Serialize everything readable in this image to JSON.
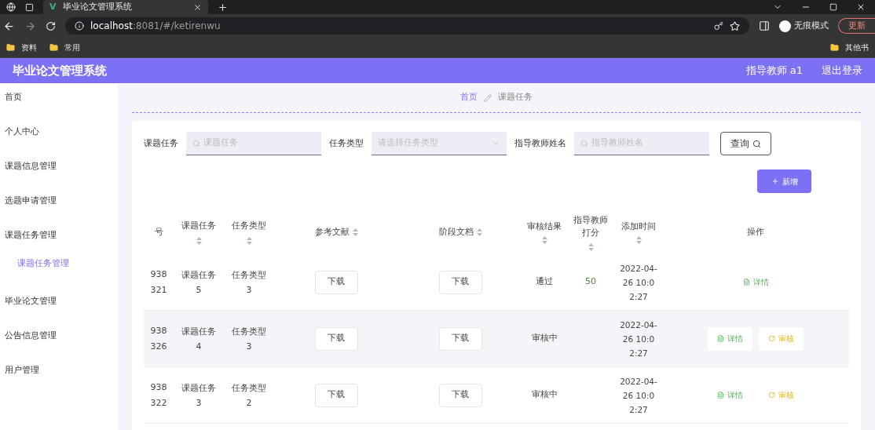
{
  "browser": {
    "tab_logo": "V",
    "tab_title": "毕业论文管理系统",
    "url_host": "localhost",
    "url_rest": ":8081/#/ketirenwu",
    "profile": "无痕模式",
    "update_button": "更新",
    "bookmarks": [
      "资料",
      "常用"
    ],
    "other_bookmarks": "其他书"
  },
  "header": {
    "title": "毕业论文管理系统",
    "user": "指导教师 a1",
    "logout": "退出登录"
  },
  "sidebar": {
    "items": [
      {
        "label": "首页",
        "selected": false
      },
      {
        "label": "个人中心",
        "selected": false
      },
      {
        "label": "课题信息管理",
        "selected": false
      },
      {
        "label": "选题申请管理",
        "selected": false
      },
      {
        "label": "课题任务管理",
        "selected": false,
        "children": [
          {
            "label": "课题任务管理",
            "selected": true
          }
        ]
      },
      {
        "label": "毕业论文管理",
        "selected": false
      },
      {
        "label": "公告信息管理",
        "selected": false
      },
      {
        "label": "用户管理",
        "selected": false
      }
    ]
  },
  "breadcrumb": [
    "首页",
    "课题任务"
  ],
  "search": {
    "fields": [
      {
        "label": "课题任务",
        "placeholder": "课题任务",
        "kind": "input"
      },
      {
        "label": "任务类型",
        "placeholder": "请选择任务类型",
        "kind": "select"
      },
      {
        "label": "指导教师姓名",
        "placeholder": "指导教师姓名",
        "kind": "input"
      }
    ],
    "query_button": "查询",
    "add_button": "新增"
  },
  "table": {
    "columns": [
      {
        "label": "号",
        "sortable": false
      },
      {
        "label": "课题任务",
        "sortable": true
      },
      {
        "label": "任务类型",
        "sortable": true
      },
      {
        "label": "参考文献",
        "sortable": true
      },
      {
        "label": "阶段文档",
        "sortable": true
      },
      {
        "label": "审核结果",
        "sortable": true
      },
      {
        "label": "指导教师打分",
        "sortable": true
      },
      {
        "label": "添加时间",
        "sortable": true
      },
      {
        "label": "操作",
        "sortable": false
      }
    ],
    "rows": [
      {
        "id": [
          "938",
          "321"
        ],
        "task": "课题任务5",
        "type": "任务类型3",
        "ref": "下载",
        "stage": "下载",
        "result": "通过",
        "score": "50",
        "time": "2022-04-26 10:02:27",
        "actions": [
          {
            "kind": "detail",
            "label": "详情"
          }
        ]
      },
      {
        "id": [
          "938",
          "326"
        ],
        "task": "课题任务4",
        "type": "任务类型3",
        "ref": "下载",
        "stage": "下载",
        "result": "审核中",
        "time": "2022-04-26 10:02:27",
        "actions": [
          {
            "kind": "detail",
            "label": "详情"
          },
          {
            "kind": "review",
            "label": "审核"
          }
        ]
      },
      {
        "id": [
          "938",
          "322"
        ],
        "task": "课题任务3",
        "type": "任务类型2",
        "ref": "下载",
        "stage": "下载",
        "result": "审核中",
        "time": "2022-04-26 10:02:27",
        "actions": [
          {
            "kind": "detail",
            "label": "详情"
          },
          {
            "kind": "review",
            "label": "审核"
          }
        ]
      }
    ]
  }
}
